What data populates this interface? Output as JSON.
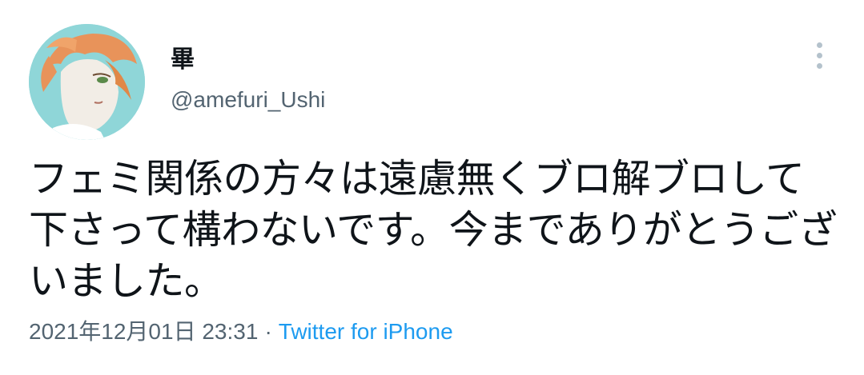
{
  "tweet": {
    "display_name": "畢",
    "handle": "@amefuri_Ushi",
    "text": "フェミ関係の方々は遠慮無くブロ解ブロして下さって構わないです。今までありがとうございました。",
    "timestamp": "2021年12月01日 23:31",
    "separator": "·",
    "source": "Twitter for iPhone"
  },
  "icons": {
    "more": "more-options-icon",
    "avatar": "user-avatar"
  },
  "colors": {
    "text": "#0f1419",
    "secondary": "#536471",
    "link": "#1d9bf0"
  }
}
